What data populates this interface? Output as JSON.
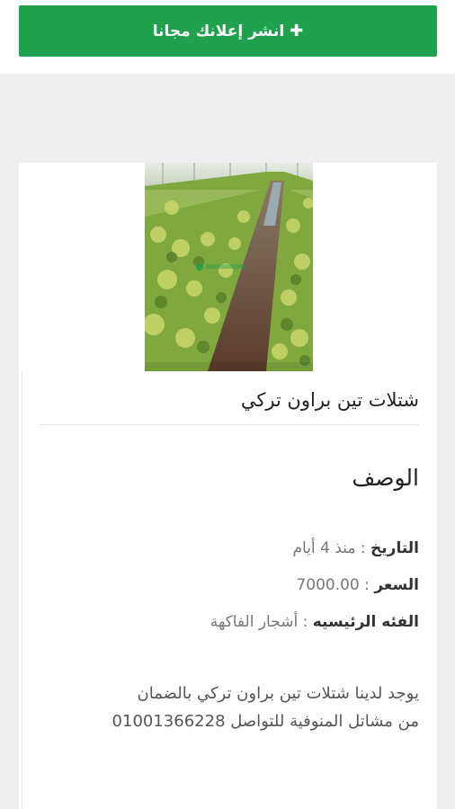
{
  "header": {
    "post_ad_label": "انشر إعلانك مجانا",
    "plus_icon": "plus-icon",
    "accent_color": "#1fa14d"
  },
  "listing": {
    "title": "شتلات تين براون تركي",
    "description_heading": "الوصف",
    "date_label": "التاريخ",
    "date_value": "منذ 4 أيام",
    "price_label": "السعر",
    "price_value": "7000.00",
    "category_label": "الفئه الرئيسيه",
    "category_value": "أشجار الفاكهة",
    "separator": " : ",
    "description_line_1": "يوجد لدينا شتلات تين براون تركي بالضمان",
    "description_line_2": "من مشاتل المنوفية للتواصل 01001366228"
  }
}
